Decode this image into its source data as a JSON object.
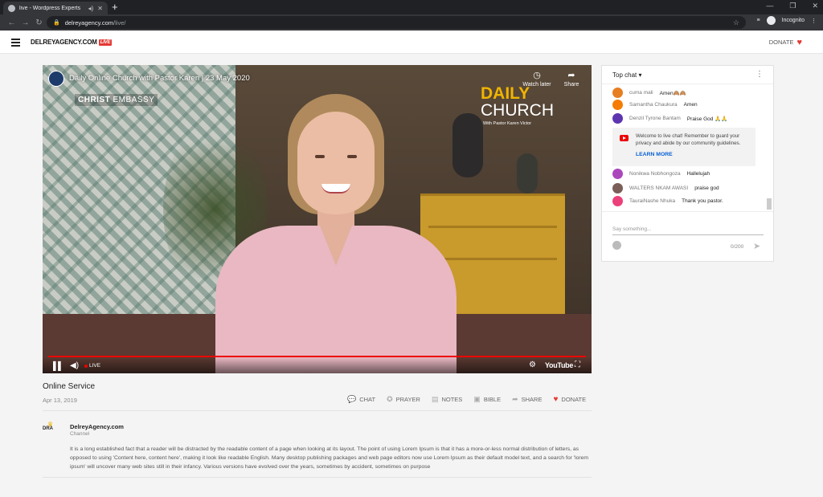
{
  "browser": {
    "tab_title": "live - Wordpress Experts",
    "url_host": "delreyagency.com",
    "url_path": "/live/",
    "profile_label": "Incognito"
  },
  "site": {
    "logo_text": "DELREYAGENCY.COM",
    "logo_badge": "LIVE",
    "donate_label": "DONATE"
  },
  "video": {
    "title": "Daily Online Church with Pastor Karen | 23 May 2020",
    "watch_later": "Watch later",
    "share": "Share",
    "brand_christ": "CHRIST",
    "brand_embassy": "EMBASSY",
    "brand_daily": "DAILY",
    "brand_church": "CHURCH",
    "brand_with": "With Pastor Karen Victor",
    "live_label": "LIVE",
    "youtube_label": "YouTube"
  },
  "service": {
    "title": "Online Service",
    "date": "Apr 13, 2019",
    "actions": [
      {
        "label": "CHAT",
        "icon": "chat-icon"
      },
      {
        "label": "PRAYER",
        "icon": "prayer-icon"
      },
      {
        "label": "NOTES",
        "icon": "notes-icon"
      },
      {
        "label": "BIBLE",
        "icon": "bible-icon"
      },
      {
        "label": "SHARE",
        "icon": "share-icon"
      },
      {
        "label": "DONATE",
        "icon": "heart-icon"
      }
    ]
  },
  "channel": {
    "logo_text": "DRA",
    "name": "DelreyAgency.com",
    "subtitle": "Channel",
    "description": "It is a long established fact that a reader will be distracted by the readable content of a page when looking at its layout. The point of using Lorem Ipsum is that it has a more-or-less normal distribution of letters, as opposed to using 'Content here, content here', making it look like readable English. Many desktop publishing packages and web page editors now use Lorem Ipsum as their default model text, and a search for 'lorem ipsum' will uncover many web sites still in their infancy. Various versions have evolved over the years, sometimes by accident, sometimes on purpose"
  },
  "chat": {
    "header": "Top chat",
    "messages": [
      {
        "author": "cuma mali",
        "text": "Amen🙈🙈",
        "color": "#e67e22"
      },
      {
        "author": "Samantha Chaukura",
        "text": "Amen",
        "color": "#f57c00"
      },
      {
        "author": "Denzil Tyrone Bantam",
        "text": "Praise God 🙏🙏",
        "color": "#5e35b1"
      },
      {
        "author": "Nonikwa Nobhongoza",
        "text": "Hallelujah",
        "color": "#ab47bc"
      },
      {
        "author": "WALTERS NKAM AWASI",
        "text": "praise god",
        "color": "#7b5e57"
      },
      {
        "author": "TauraiNashe Nhuka",
        "text": "Thank you pastor.",
        "color": "#ec407a"
      }
    ],
    "notice_text": "Welcome to live chat! Remember to guard your privacy and abide by our community guidelines.",
    "learn_more": "LEARN MORE",
    "input_placeholder": "Say something...",
    "char_count": "0/200"
  }
}
